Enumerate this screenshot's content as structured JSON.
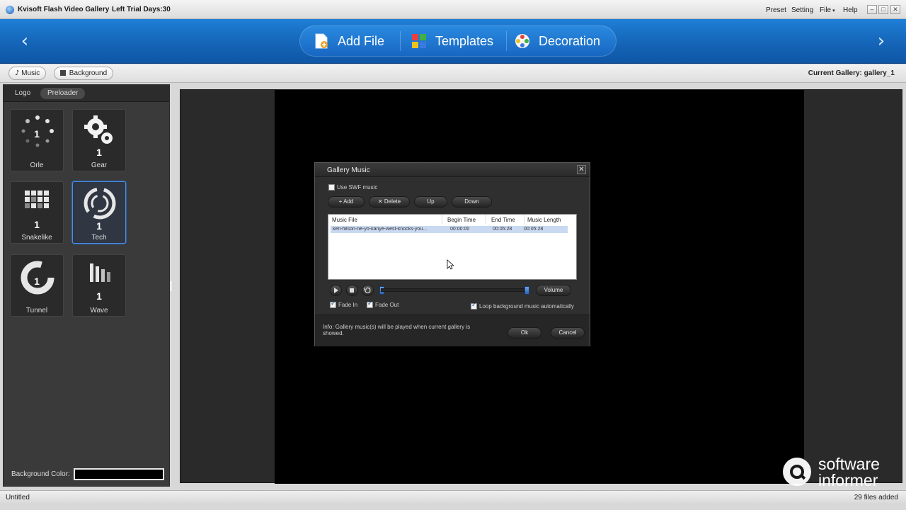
{
  "window": {
    "title": "Kvisoft Flash Video Gallery",
    "trial": "Left Trial Days:30",
    "menu": {
      "preset": "Preset",
      "setting": "Setting",
      "file": "File",
      "help": "Help"
    },
    "controls": {
      "minimize": "–",
      "maximize": "□",
      "close": "✕"
    }
  },
  "banner": {
    "prev_arrow": "‹",
    "next_arrow": "›",
    "tabs": [
      {
        "label": "Add File",
        "icon": "add-file-icon"
      },
      {
        "label": "Templates",
        "icon": "templates-icon"
      },
      {
        "label": "Decoration",
        "icon": "decoration-icon"
      }
    ]
  },
  "subbar": {
    "music": "Music",
    "background": "Background",
    "current_gallery": "Current Gallery: gallery_1"
  },
  "left_panel": {
    "tabs": [
      "Logo",
      "Preloader"
    ],
    "active_tab": "Preloader",
    "preloaders": [
      {
        "label": "Orle",
        "number": "1",
        "icon": "dots-ring-icon"
      },
      {
        "label": "Gear",
        "number": "1",
        "icon": "gear-icon"
      },
      {
        "label": "Snakelike",
        "number": "1",
        "icon": "grid-icon"
      },
      {
        "label": "Tech",
        "number": "1",
        "icon": "tech-ring-icon",
        "selected": true
      },
      {
        "label": "Tunnel",
        "number": "1",
        "icon": "tunnel-ring-icon"
      },
      {
        "label": "Wave",
        "number": "1",
        "icon": "wave-bars-icon"
      }
    ],
    "background_color_label": "Background Color:",
    "background_color": "#000000"
  },
  "dialog": {
    "title": "Gallery Music",
    "close": "✕",
    "use_swf_music": "Use SWF music",
    "buttons": {
      "add": "Add",
      "delete": "Delete",
      "up": "Up",
      "down": "Down"
    },
    "table": {
      "headers": [
        "Music File",
        "Begin Time",
        "End Time",
        "Music  Length"
      ],
      "rows": [
        [
          "keri-hilson-ne-yo-kanye-west-knocks-you...",
          "00:00:00",
          "00:05:28",
          "00:05:28"
        ]
      ]
    },
    "volume": "Volume",
    "fade_in": "Fade In",
    "fade_out": "Fade Out",
    "loop": "Loop background music automatically",
    "info": "Info: Gallery music(s) will be played when current gallery is showed.",
    "ok": "Ok",
    "cancel": "Cancel"
  },
  "status": {
    "left": "Untitled",
    "right": "29 files added"
  },
  "watermark": {
    "line1": "software",
    "line2": "informer"
  },
  "colors": {
    "banner_blue": "#1565b8",
    "selection_blue": "#4c8ee0",
    "stage_black": "#000000"
  }
}
